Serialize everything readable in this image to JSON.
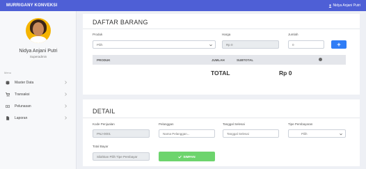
{
  "topbar": {
    "brand": "MURRIGANY KONVEKSI",
    "user_name": "Nidya Anjani Putri"
  },
  "sidebar": {
    "profile_name": "Nidya Anjani Putri",
    "profile_role": "Superadmin",
    "menu_heading": "Menu",
    "items": [
      {
        "label": "Master Data",
        "icon": "database-icon"
      },
      {
        "label": "Transaksi",
        "icon": "cart-icon"
      },
      {
        "label": "Pelunasan",
        "icon": "money-icon"
      },
      {
        "label": "Laporan",
        "icon": "file-icon"
      }
    ]
  },
  "daftar_barang": {
    "title": "DAFTAR BARANG",
    "produk_label": "Produk",
    "produk_value": "Pilih",
    "harga_label": "Harga",
    "harga_value": "Rp 0",
    "jumlah_label": "Jumlah",
    "jumlah_value": "0",
    "add_button": "+",
    "table_headers": {
      "produk": "PRODUK",
      "jumlah": "JUMLAH",
      "subtotal": "SUBTOTAL"
    },
    "total_label": "TOTAL",
    "total_value": "Rp 0"
  },
  "detail": {
    "title": "DETAIL",
    "kode_label": "Kode Penjualan",
    "kode_value": "PNJ-0001",
    "pelanggan_label": "Pelanggan",
    "pelanggan_placeholder": "Nama Pelanggan...",
    "tanggal_label": "Tanggal Selesai",
    "tanggal_placeholder": "Tanggal Selesai",
    "tipe_label": "Tipe Pembayaran",
    "tipe_value": "Pilih",
    "total_bayar_label": "Total Bayar",
    "total_bayar_value": "Silahkan Pilih Tipe Pembayar",
    "save_button": "SIMPAN"
  },
  "colors": {
    "topbar": "#4e5fd6",
    "primary_button": "#2f7df6",
    "save_button": "#6dd46d"
  }
}
